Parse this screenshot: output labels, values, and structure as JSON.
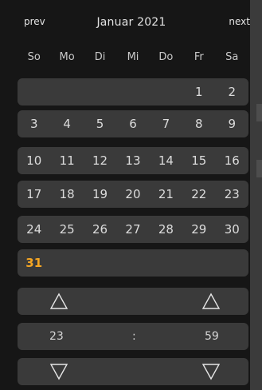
{
  "header": {
    "prev_label": "prev",
    "title": "Januar 2021",
    "next_label": "next"
  },
  "weekdays": [
    "So",
    "Mo",
    "Di",
    "Mi",
    "Do",
    "Fr",
    "Sa"
  ],
  "weeks": [
    [
      "",
      "",
      "",
      "",
      "",
      "1",
      "2"
    ],
    [
      "3",
      "4",
      "5",
      "6",
      "7",
      "8",
      "9"
    ],
    [
      "10",
      "11",
      "12",
      "13",
      "14",
      "15",
      "16"
    ],
    [
      "17",
      "18",
      "19",
      "20",
      "21",
      "22",
      "23"
    ],
    [
      "24",
      "25",
      "26",
      "27",
      "28",
      "29",
      "30"
    ],
    [
      "31",
      "",
      "",
      "",
      "",
      "",
      ""
    ]
  ],
  "today": "31",
  "time": {
    "hours": "23",
    "separator": ":",
    "minutes": "59"
  },
  "colors": {
    "background": "#161616",
    "row": "#3a3a3a",
    "text": "#dcdcdc",
    "accent": "#f5a623"
  }
}
